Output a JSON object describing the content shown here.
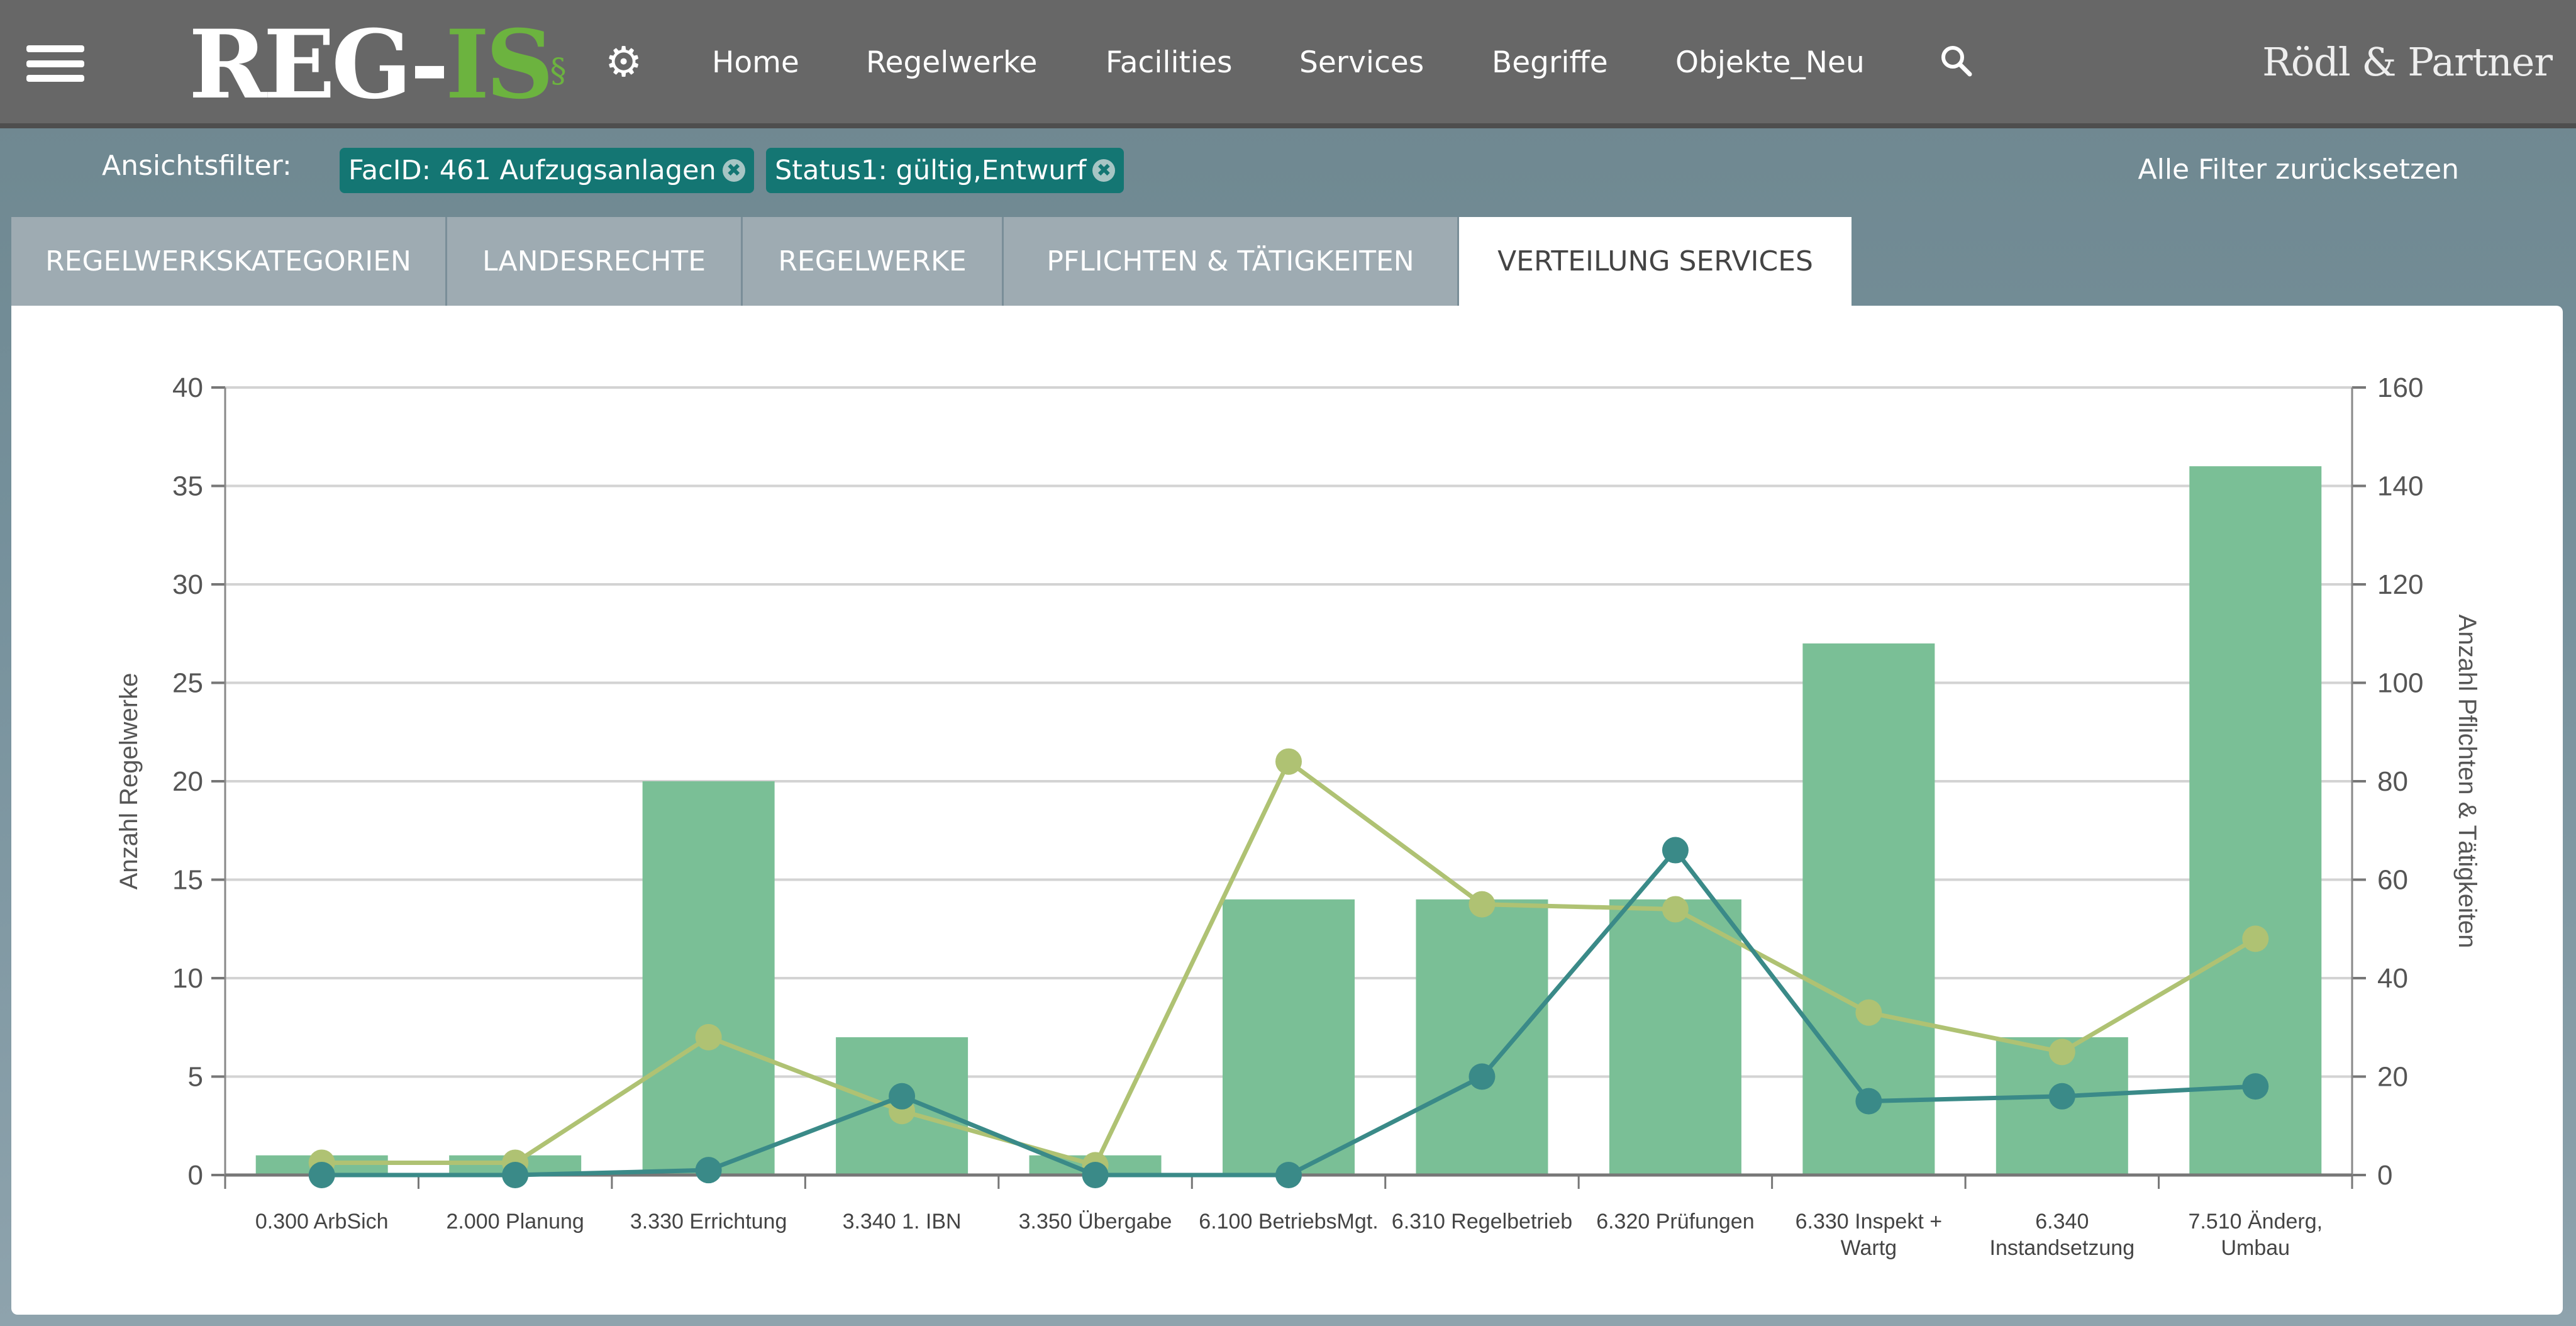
{
  "header": {
    "logo": {
      "part1": "REG-",
      "part2": "IS",
      "mark": "§"
    },
    "nav": [
      "Home",
      "Regelwerke",
      "Facilities",
      "Services",
      "Begriffe",
      "Objekte_Neu"
    ],
    "brand": "Rödl & Partner",
    "icons": {
      "menu": "hamburger-icon",
      "settings": "gear-icon",
      "search": "search-icon"
    }
  },
  "filters": {
    "label": "Ansichtsfilter:",
    "chips": [
      "FacID: 461 Aufzugsanlagen",
      "Status1: gültig,Entwurf"
    ],
    "reset": "Alle Filter zurücksetzen"
  },
  "tabs": [
    "REGELWERKSKATEGORIEN",
    "LANDESRECHTE",
    "REGELWERKE",
    "PFLICHTEN & TÄTIGKEITEN",
    "VERTEILUNG SERVICES"
  ],
  "active_tab": "VERTEILUNG SERVICES",
  "chart_data": {
    "type": "bar+line",
    "categories": [
      [
        "0.300 ArbSich"
      ],
      [
        "2.000 Planung"
      ],
      [
        "3.330 Errichtung"
      ],
      [
        "3.340 1. IBN"
      ],
      [
        "3.350 Übergabe"
      ],
      [
        "6.100 BetriebsMgt."
      ],
      [
        "6.310 Regelbetrieb"
      ],
      [
        "6.320 Prüfungen"
      ],
      [
        "6.330 Inspekt +",
        "Wartg"
      ],
      [
        "6.340",
        "Instandsetzung"
      ],
      [
        "7.510 Änderg,",
        "Umbau"
      ]
    ],
    "ylabel_left": "Anzahl Regelwerke",
    "ylabel_right": "Anzahl Pflichten & Tätigkeiten",
    "ylim_left": [
      0,
      40
    ],
    "yticks_left": [
      0,
      5,
      10,
      15,
      20,
      25,
      30,
      35,
      40
    ],
    "ylim_right": [
      0,
      160
    ],
    "yticks_right": [
      0,
      20,
      40,
      60,
      80,
      100,
      120,
      140,
      160
    ],
    "grid": true,
    "series": [
      {
        "type": "bar",
        "axis": "left",
        "color": "#7abf96",
        "values": [
          1,
          1,
          20,
          7,
          1,
          14,
          14,
          14,
          27,
          7,
          36
        ]
      },
      {
        "type": "line",
        "axis": "right",
        "color": "#afc273",
        "values": [
          2.5,
          2.5,
          28,
          13,
          2,
          84,
          55,
          54,
          33,
          25,
          48
        ]
      },
      {
        "type": "line",
        "axis": "right",
        "color": "#3a8a88",
        "values": [
          0,
          0,
          1,
          16,
          0,
          0,
          20,
          66,
          15,
          16,
          18
        ]
      }
    ]
  }
}
